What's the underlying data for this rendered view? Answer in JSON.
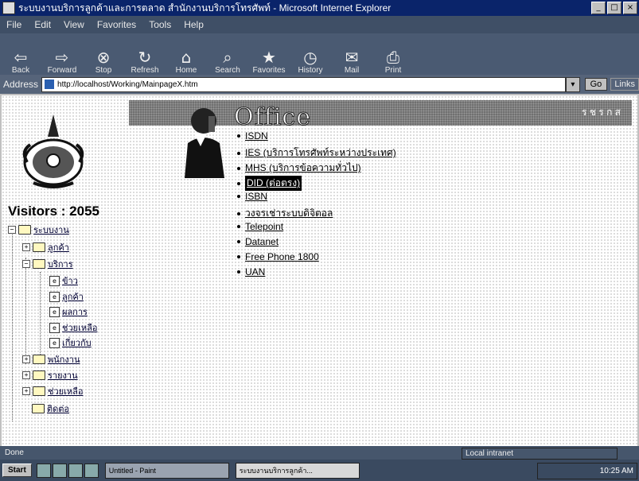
{
  "window": {
    "title": "ระบบงานบริการลูกค้าและการตลาด สำนักงานบริการโทรศัพท์ - Microsoft Internet Explorer",
    "controls": [
      "_",
      "□",
      "×"
    ]
  },
  "menubar": {
    "items": [
      "File",
      "Edit",
      "View",
      "Favorites",
      "Tools",
      "Help"
    ]
  },
  "toolbar": {
    "buttons": [
      {
        "icon": "back-arrow-icon",
        "glyph": "⇦",
        "label": "Back"
      },
      {
        "icon": "forward-arrow-icon",
        "glyph": "⇨",
        "label": "Forward"
      },
      {
        "icon": "stop-icon",
        "glyph": "⊗",
        "label": "Stop"
      },
      {
        "icon": "refresh-icon",
        "glyph": "↻",
        "label": "Refresh"
      },
      {
        "icon": "home-icon",
        "glyph": "⌂",
        "label": "Home"
      },
      {
        "icon": "search-icon",
        "glyph": "⌕",
        "label": "Search"
      },
      {
        "icon": "favorites-icon",
        "glyph": "★",
        "label": "Favorites"
      },
      {
        "icon": "history-icon",
        "glyph": "◷",
        "label": "History"
      },
      {
        "icon": "mail-icon",
        "glyph": "✉",
        "label": "Mail"
      },
      {
        "icon": "print-icon",
        "glyph": "⎙",
        "label": "Print"
      }
    ]
  },
  "address": {
    "label": "Address",
    "url": "http://localhost/Working/MainpageX.htm",
    "go": "Go",
    "links": "Links"
  },
  "sidebar": {
    "visitors": "Visitors : 2055",
    "tree": {
      "root": "ระบบงาน",
      "items": [
        "ลูกค้า",
        "บริการ",
        "ข้าว",
        "ลูกค้า",
        "ผลการ",
        "ช่วยเหลือ",
        "เกี่ยวกับ",
        "พนักงาน",
        "รายงาน",
        "ช่วยเหลือ",
        "ติดต่อ"
      ]
    }
  },
  "banner": {
    "word": "Office",
    "right_text": "ร ช ร ก ส"
  },
  "links": [
    {
      "label": "ISDN"
    },
    {
      "label": "IES (บริการโทรศัพท์ระหว่างประเทศ)"
    },
    {
      "label": "MHS (บริการข้อความทั่วไป)"
    },
    {
      "label": "DID (ต่อตรง)"
    },
    {
      "label": "ISBN"
    },
    {
      "label": "วงจรเช่าระบบดิจิตอล"
    },
    {
      "label": "Telepoint"
    },
    {
      "label": "Datanet"
    },
    {
      "label": "Free Phone 1800"
    },
    {
      "label": "UAN"
    }
  ],
  "statusbar": {
    "left": "Done",
    "zone": "Local intranet"
  },
  "taskbar": {
    "start": "Start",
    "items": [
      "Untitled - Paint",
      "ระบบงานบริการลูกค้า..."
    ],
    "clock": "10:25 AM"
  }
}
